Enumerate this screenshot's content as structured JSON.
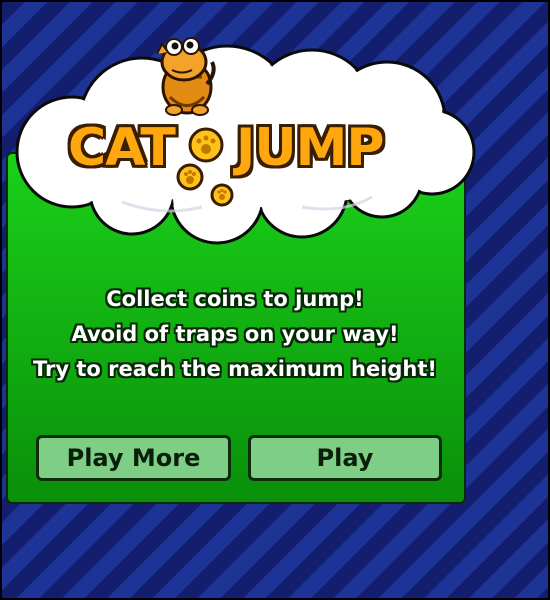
{
  "game": {
    "title_left": "CAT",
    "title_right": "JUMP",
    "mascot": "cat-icon",
    "coin_icon": "paw-coin-icon"
  },
  "instructions": [
    "Collect coins to jump!",
    "Avoid of traps on your way!",
    "Try to reach the maximum height!"
  ],
  "buttons": {
    "play_more": "Play More",
    "play": "Play"
  },
  "colors": {
    "background_stripe_dark": "#131f6e",
    "background_stripe_light": "#1d3396",
    "panel_green": "#1ad11a",
    "button_green": "#7fce85",
    "title_orange": "#ffa70f",
    "coin_gold": "#ffc21a"
  }
}
